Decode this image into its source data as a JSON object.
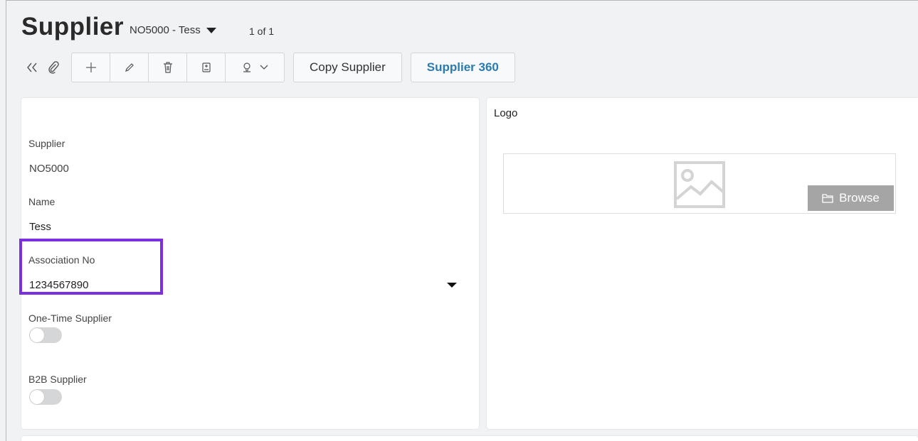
{
  "header": {
    "title": "Supplier",
    "record_selector": "NO5000 - Tess",
    "pager": "1 of 1"
  },
  "toolbar": {
    "collapse_icon": "double-chevron-left-icon",
    "attach_icon": "paperclip-icon",
    "buttons": [
      {
        "name": "add",
        "icon": "plus-icon"
      },
      {
        "name": "edit",
        "icon": "pencil-icon"
      },
      {
        "name": "delete",
        "icon": "trash-icon"
      },
      {
        "name": "duplicate",
        "icon": "copy-icon"
      },
      {
        "name": "assistant",
        "icon": "person-pin-icon"
      }
    ],
    "copy_supplier_label": "Copy Supplier",
    "supplier_360_label": "Supplier 360",
    "accent_color": "#2b7bb0"
  },
  "form": {
    "supplier": {
      "label": "Supplier",
      "value": "NO5000"
    },
    "name": {
      "label": "Name",
      "value": "Tess"
    },
    "association_no": {
      "label": "Association No",
      "value": "1234567890"
    },
    "one_time_supplier": {
      "label": "One-Time Supplier",
      "checked": false
    },
    "b2b_supplier": {
      "label": "B2B Supplier",
      "checked": false
    },
    "highlight_color": "#7c2fe0"
  },
  "logo": {
    "label": "Logo",
    "browse_label": "Browse"
  }
}
